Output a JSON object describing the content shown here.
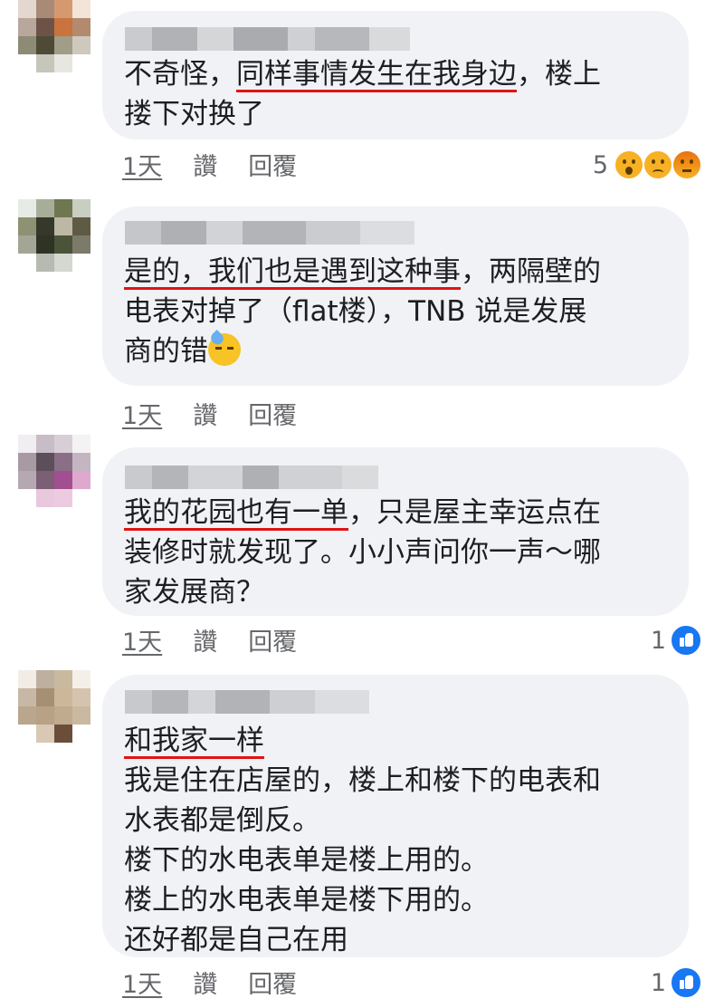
{
  "colors": {
    "bubble": "#f0f2f5",
    "underline": "#e01414",
    "like": "#1877f2",
    "meta_text": "#65676b"
  },
  "comments": [
    {
      "text_parts": [
        "不奇怪，",
        "同样事情发生在我身边",
        "，楼上\n搂下对换了"
      ],
      "actions": {
        "time": "1天",
        "like": "讚",
        "reply": "回覆"
      },
      "reactions": {
        "count": "5",
        "icons": [
          "wow-icon",
          "sad-icon",
          "angry-icon"
        ]
      }
    },
    {
      "text_parts": [
        "是的，我们也是遇到这种事",
        "，两隔壁的\n电表对掉了（flat楼），TNB 说是发展\n商的错"
      ],
      "emoji": "sweat-emoji",
      "actions": {
        "time": "1天",
        "like": "讚",
        "reply": "回覆"
      }
    },
    {
      "text_parts": [
        "我的花园也有一单",
        "，只是屋主幸运点在\n装修时就发现了。小小声问你一声～哪\n家发展商？"
      ],
      "actions": {
        "time": "1天",
        "like": "讚",
        "reply": "回覆"
      },
      "reactions": {
        "count": "1",
        "icons": [
          "like-icon"
        ]
      }
    },
    {
      "text_parts": [
        "和我家一样",
        "\n我是住在店屋的，楼上和楼下的电表和\n水表都是倒反。\n楼下的水电表单是楼上用的。\n楼上的水电表单是楼下用的。\n还好都是自己在用"
      ],
      "actions": {
        "time": "1天",
        "like": "讚",
        "reply": "回覆"
      },
      "reactions": {
        "count": "1",
        "icons": [
          "like-icon"
        ]
      }
    }
  ]
}
